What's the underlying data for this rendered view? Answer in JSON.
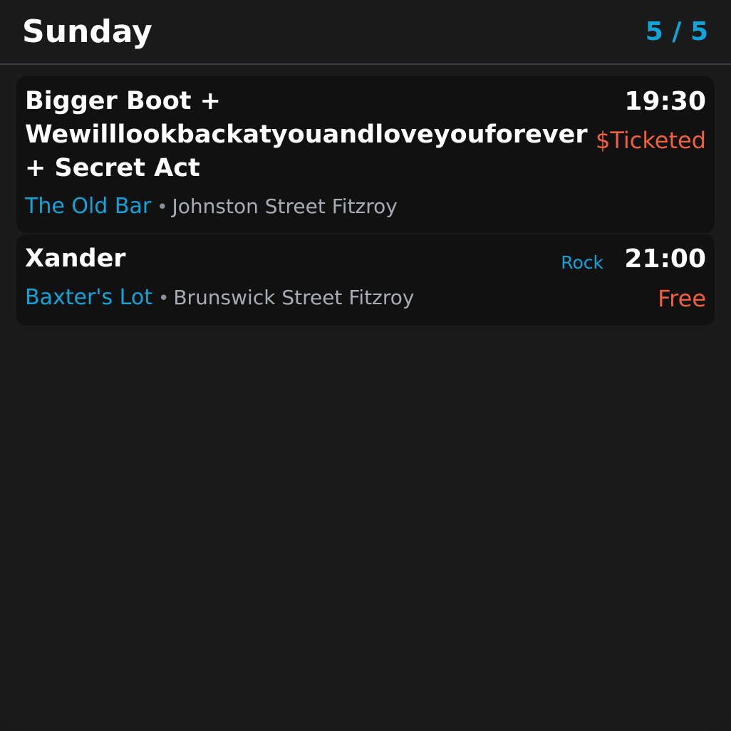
{
  "header": {
    "day": "Sunday",
    "page_indicator": "5 / 5"
  },
  "events": [
    {
      "title_lines": [
        "Bigger Boot +",
        "Wewilllookbackatyouandloveyouforever",
        "+ Secret Act"
      ],
      "time": "19:30",
      "price": "$Ticketed",
      "venue": "The Old Bar",
      "separator": "•",
      "address": "Johnston Street Fitzroy"
    },
    {
      "title_lines": [
        "Xander"
      ],
      "genre": "Rock",
      "time": "21:00",
      "price": "Free",
      "venue": "Baxter's Lot",
      "separator": "•",
      "address": "Brunswick Street Fitzroy"
    }
  ],
  "colors": {
    "accent": "#12a3d9",
    "price": "#f0603c",
    "background": "#1a1a1a",
    "card": "#111111"
  }
}
